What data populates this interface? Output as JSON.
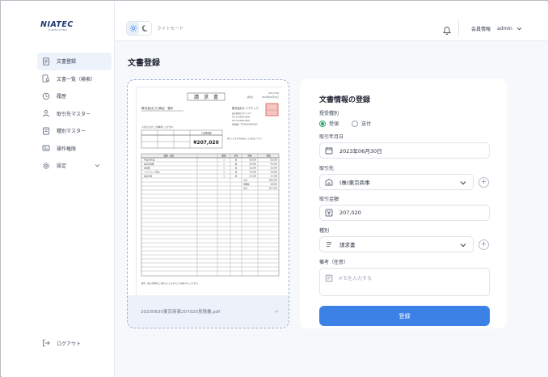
{
  "brand": {
    "logo_text": "NIATEC",
    "logo_sub": "CONSULTING"
  },
  "topbar": {
    "mode_label": "ライトモード",
    "user_label": "会員情報",
    "user_name": "admin"
  },
  "sidebar": {
    "items": [
      {
        "label": "文書登録",
        "icon": "document-add-icon",
        "active": true
      },
      {
        "label": "文書一覧（検索）",
        "icon": "document-search-icon",
        "active": false
      },
      {
        "label": "履歴",
        "icon": "history-icon",
        "active": false
      },
      {
        "label": "取引先マスター",
        "icon": "partner-icon",
        "active": false
      },
      {
        "label": "種別マスター",
        "icon": "category-icon",
        "active": false
      },
      {
        "label": "操作権限",
        "icon": "permission-icon",
        "active": false
      },
      {
        "label": "設定",
        "icon": "gear-icon",
        "active": false
      }
    ],
    "logout_label": "ログアウト"
  },
  "main": {
    "page_title": "文書登録",
    "preview": {
      "doc_title": "請　求　書",
      "no_label": "請求書No",
      "no_value": "R00-2106",
      "date_label": "請求日：",
      "date_value": "2023年06月30日",
      "client": "株式会社〇〇商店　御中",
      "issuer": "株式会社ナイアテック",
      "issuer_lines": [
        "東京都港区〇〇 1-2-3",
        "TEL 03-0000-0000",
        "FAX 03-0000-0001",
        "登録番号 T0000000000000"
      ],
      "stamp": "ナイアテック",
      "greeting": "下記のとおりご請求申し上げます。",
      "amount_label": "ご請求金額",
      "amount_value": "¥207,020",
      "due_note": "恐れ入りますがお振込にてお支払い下さい",
      "table_header": [
        "品番・品名",
        "数量",
        "単位",
        "単価",
        "金額"
      ],
      "rows": [
        [
          "PC保守作業",
          "1",
          "式",
          "50,000",
          "50,000"
        ],
        [
          "部品交換費",
          "2",
          "個",
          "20,000",
          "40,000"
        ],
        [
          "出張費",
          "1",
          "式",
          "12,000",
          "12,000"
        ],
        [
          "ソフトウェア導入",
          "1",
          "式",
          "70,000",
          "70,000"
        ],
        [
          "設定作業",
          "1",
          "式",
          "17,200",
          "17,200"
        ]
      ],
      "subtotal_label": "小計",
      "subtotal_value": "188,200",
      "tax_label": "消費税",
      "tax_value": "18,820",
      "total_label": "合計",
      "total_value": "207,020",
      "footer_note": "備考：振込手数料はご負担いただきますようお願い申し上げます。"
    },
    "file_name": "20230630東京商事207020見積書.pdf"
  },
  "form": {
    "title": "文書情報の登録",
    "type_label": "授受種別",
    "radio_received": "受領",
    "radio_sent": "送付",
    "radio_selected": "received",
    "date_label": "取引年月日",
    "date_value": "2023年06月30日",
    "partner_label": "取引先",
    "partner_value": "(株)東京商事",
    "amount_label": "取引金額",
    "amount_value": "207,020",
    "kind_label": "種別",
    "kind_value": "請求書",
    "memo_label": "備考（任意）",
    "memo_placeholder": "メモを入力する",
    "submit_label": "登録"
  },
  "colors": {
    "accent": "#3c82e6",
    "radio_green": "#2fa36b",
    "sidebar_active": "#eef3fb",
    "stamp_red": "#d9534f"
  }
}
